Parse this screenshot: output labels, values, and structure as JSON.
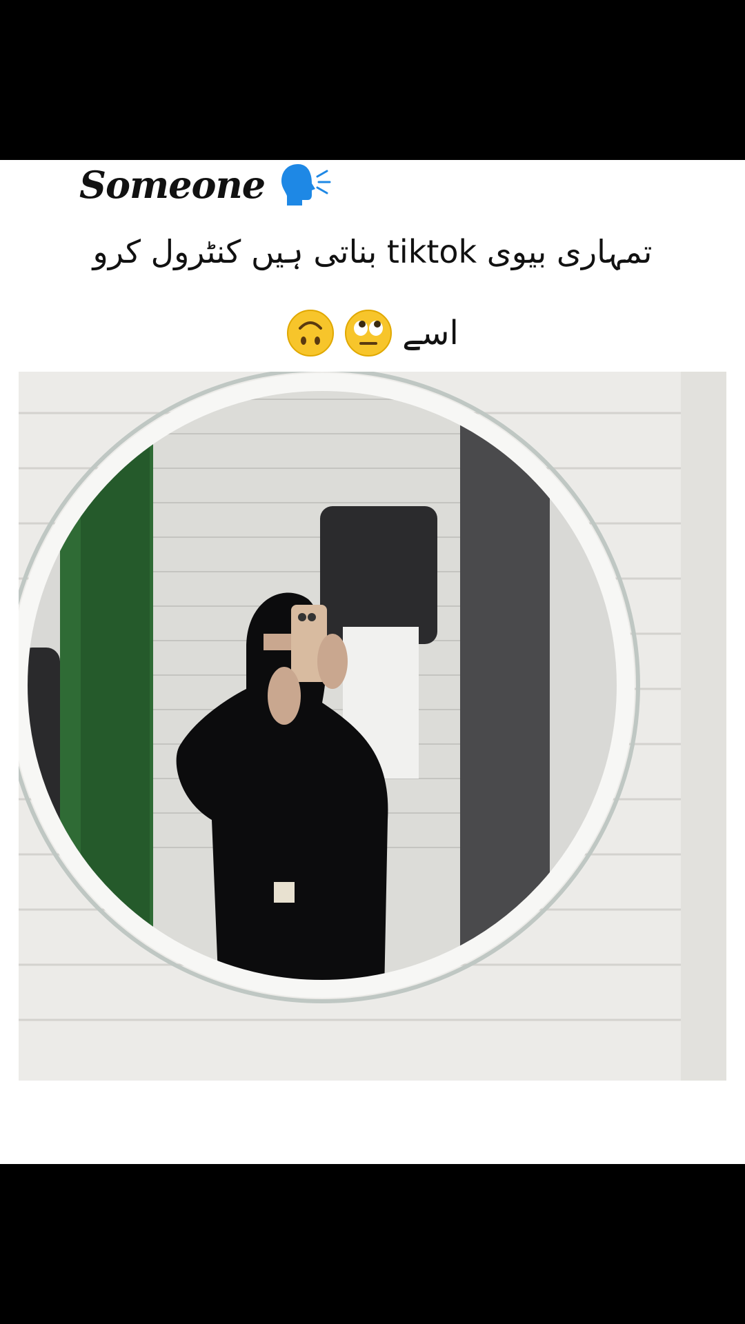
{
  "meme": {
    "speaker_label": "Someone",
    "speaker_icon": "speaking-head-icon",
    "urdu_line1": "تمہاری بیوی tiktok بناتی ہیں کنٹرول کرو",
    "urdu_line2_word": "اسے",
    "emoji_1": "upside-down-face-icon",
    "emoji_2": "eye-roll-face-icon"
  },
  "colors": {
    "background": "#000000",
    "panel": "#ffffff",
    "speaker_icon": "#1e88e5",
    "emoji": "#f7c52b"
  }
}
